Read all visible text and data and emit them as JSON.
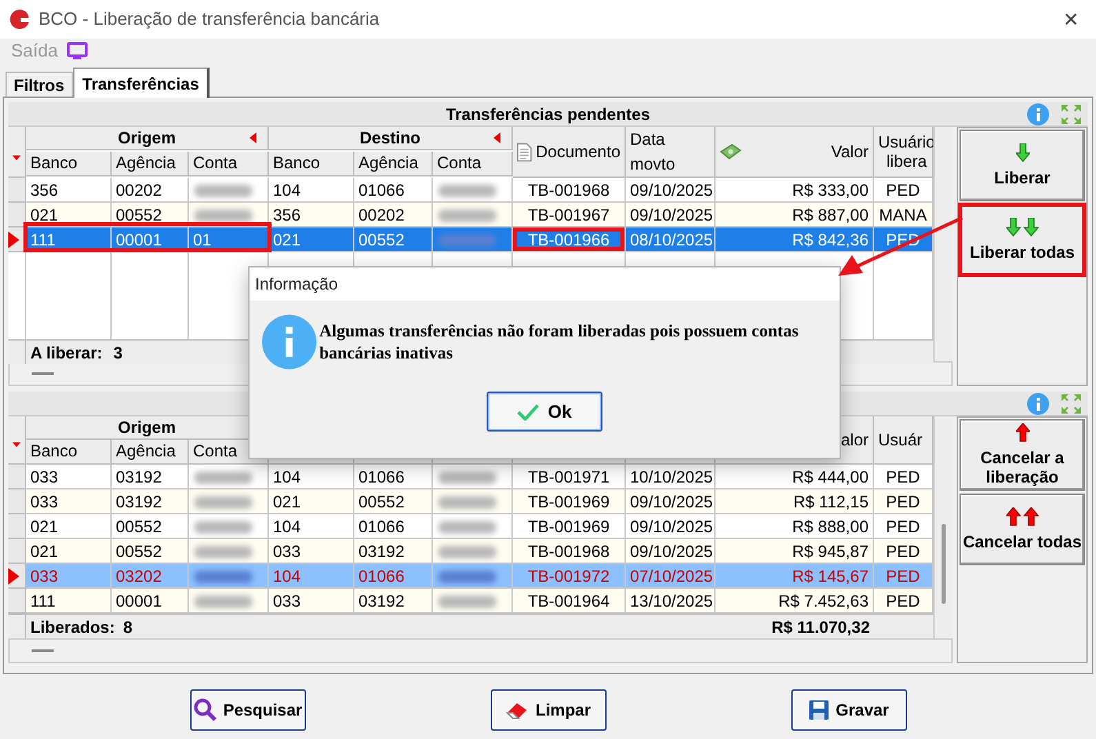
{
  "window": {
    "title": "BCO - Liberação de transferência bancária",
    "close_glyph": "✕"
  },
  "menu": [
    {
      "label": "Saída"
    }
  ],
  "tabs": [
    {
      "label": "Filtros",
      "selected": false
    },
    {
      "label": "Transferências",
      "selected": true
    }
  ],
  "pending": {
    "title": "Transferências pendentes",
    "group_headers": [
      "Origem",
      "Destino"
    ],
    "columns": [
      "Banco",
      "Agência",
      "Conta",
      "Banco",
      "Agência",
      "Conta",
      "Documento",
      "Data movto",
      "Valor",
      "Usuário libera"
    ],
    "rows": [
      {
        "selected": false,
        "cells": [
          "356",
          "00202",
          {
            "blurred": true
          },
          "104",
          "01066",
          {
            "blurred": true
          },
          "TB-001968",
          "09/10/2025",
          "R$ 333,00",
          "PED"
        ]
      },
      {
        "selected": false,
        "cells": [
          "021",
          "00552",
          {
            "blurred": true
          },
          "356",
          "00202",
          {
            "blurred": true
          },
          "TB-001967",
          "09/10/2025",
          "R$ 887,00",
          "MANA"
        ]
      },
      {
        "selected": true,
        "highlight_origin": true,
        "highlight_document": true,
        "cells": [
          "111",
          "00001",
          "01",
          "021",
          "00552",
          {
            "blurred": true
          },
          "TB-001966",
          "08/10/2025",
          "R$ 842,36",
          "PED"
        ]
      }
    ],
    "footer_label": "A liberar:",
    "footer_count": "3",
    "buttons": [
      {
        "kind": "release_one",
        "label": "Liberar",
        "highlighted": false
      },
      {
        "kind": "release_all",
        "label": "Liberar todas",
        "highlighted": true
      }
    ]
  },
  "released": {
    "group_headers": [
      "Origem"
    ],
    "columns": [
      "Banco",
      "Agência",
      "Conta"
    ],
    "value_column": "alor",
    "user_column": "Usuár",
    "rows": [
      {
        "selected": false,
        "flagged": false,
        "cells": [
          "033",
          "03192",
          {
            "blurred": true
          },
          "104",
          "01066",
          {
            "blurred": true
          },
          "TB-001971",
          "10/10/2025",
          "R$ 444,00",
          "PED"
        ]
      },
      {
        "selected": false,
        "flagged": false,
        "cells": [
          "033",
          "03192",
          {
            "blurred": true
          },
          "021",
          "00552",
          {
            "blurred": true
          },
          "TB-001969",
          "09/10/2025",
          "R$ 112,15",
          "PED"
        ]
      },
      {
        "selected": false,
        "flagged": false,
        "cells": [
          "021",
          "00552",
          {
            "blurred": true
          },
          "104",
          "01066",
          {
            "blurred": true
          },
          "TB-001969",
          "09/10/2025",
          "R$ 888,00",
          "PED"
        ]
      },
      {
        "selected": false,
        "flagged": false,
        "cells": [
          "021",
          "00552",
          {
            "blurred": true
          },
          "033",
          "03192",
          {
            "blurred": true
          },
          "TB-001968",
          "09/10/2025",
          "R$ 945,87",
          "PED"
        ]
      },
      {
        "selected": true,
        "flagged": true,
        "cells": [
          "033",
          "03202",
          {
            "blurred": true
          },
          "104",
          "01066",
          {
            "blurred": true
          },
          "TB-001972",
          "07/10/2025",
          "R$ 145,67",
          "PED"
        ]
      },
      {
        "selected": false,
        "flagged": false,
        "cells": [
          "111",
          "00001",
          {
            "blurred": true
          },
          "033",
          "03192",
          {
            "blurred": true
          },
          "TB-001964",
          "13/10/2025",
          "R$ 7.452,63",
          "PED"
        ]
      }
    ],
    "footer_label": "Liberados:",
    "footer_count": "8",
    "footer_total": "R$ 11.070,32",
    "buttons": [
      {
        "kind": "cancel_one",
        "label": "Cancelar a liberação"
      },
      {
        "kind": "cancel_all",
        "label": "Cancelar todas"
      }
    ]
  },
  "actions": [
    {
      "kind": "search",
      "label": "Pesquisar"
    },
    {
      "kind": "clear",
      "label": "Limpar"
    },
    {
      "kind": "save",
      "label": "Gravar"
    }
  ],
  "dialog": {
    "title": "Informação",
    "message": "Algumas transferências não foram liberadas pois possuem contas bancárias inativas",
    "ok_label": "Ok"
  },
  "callout_arrow": true
}
